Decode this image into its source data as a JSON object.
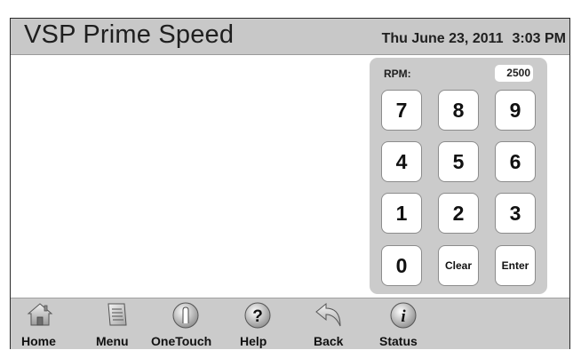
{
  "header": {
    "title": "VSP Prime Speed",
    "date": "Thu June 23, 2011",
    "time": "3:03 PM"
  },
  "keypad": {
    "rpm_label": "RPM:",
    "rpm_value": "2500",
    "keys": [
      "7",
      "8",
      "9",
      "4",
      "5",
      "6",
      "1",
      "2",
      "3",
      "0",
      "Clear",
      "Enter"
    ]
  },
  "nav": {
    "items": [
      {
        "label": "Home",
        "icon": "home-icon"
      },
      {
        "label": "Menu",
        "icon": "menu-icon"
      },
      {
        "label": "OneTouch",
        "icon": "onetouch-icon"
      },
      {
        "label": "Help",
        "icon": "help-icon"
      },
      {
        "label": "Back",
        "icon": "back-icon"
      },
      {
        "label": "Status",
        "icon": "status-icon"
      }
    ]
  }
}
